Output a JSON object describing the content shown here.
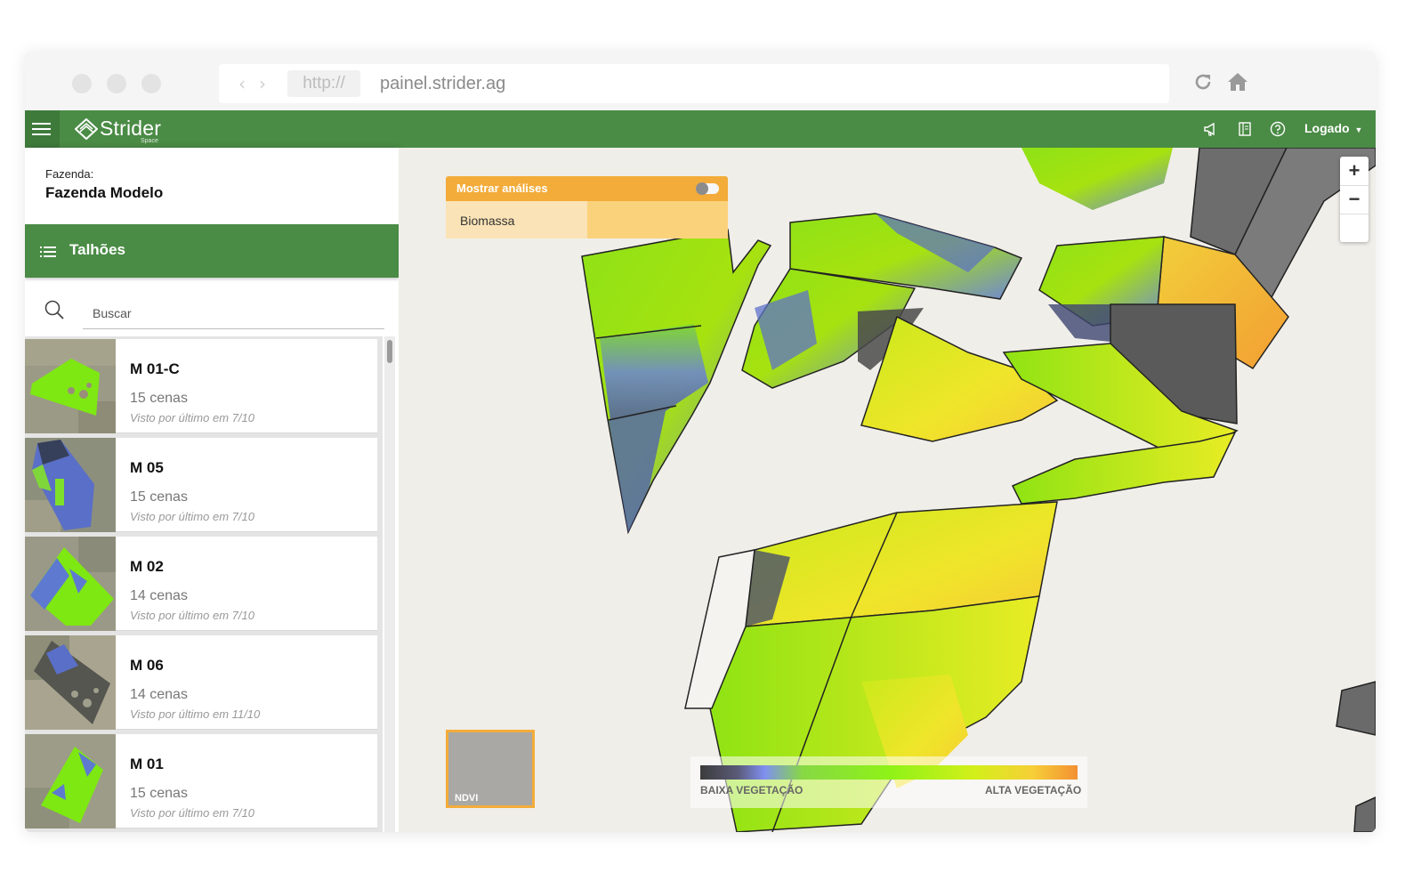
{
  "browser": {
    "protocol": "http://",
    "url": "painel.strider.ag"
  },
  "appbar": {
    "logo_text": "Strider",
    "logo_sub": "Space",
    "user_label": "Logado",
    "icons": [
      "menu-icon",
      "megaphone-icon",
      "book-icon",
      "help-icon",
      "caret-down-icon"
    ]
  },
  "sidebar": {
    "farm_label": "Fazenda:",
    "farm_name": "Fazenda Modelo",
    "plots_title": "Talhões",
    "search_placeholder": "Buscar",
    "plots": [
      {
        "name": "M 01-C",
        "scenes": "15 cenas",
        "last_seen": "Visto por último em  7/10"
      },
      {
        "name": "M 05",
        "scenes": "15 cenas",
        "last_seen": "Visto por último em  7/10"
      },
      {
        "name": "M 02",
        "scenes": "14 cenas",
        "last_seen": "Visto por último em  7/10"
      },
      {
        "name": "M 06",
        "scenes": "14 cenas",
        "last_seen": "Visto por último em  11/10"
      },
      {
        "name": "M 01",
        "scenes": "15 cenas",
        "last_seen": "Visto por último em  7/10"
      }
    ]
  },
  "map": {
    "analysis_toggle_label": "Mostrar análises",
    "analysis_item": "Biomassa",
    "zoom_in": "+",
    "zoom_out": "−",
    "layer_label": "NDVI",
    "legend_low": "BAIXA VEGETAÇÃO",
    "legend_high": "ALTA VEGETAÇÃO"
  },
  "colors": {
    "brand_green": "#4a8b45",
    "accent_orange": "#f3ac3a",
    "ndvi_low": "#3c3c3c",
    "ndvi_mid": "#8ef217",
    "ndvi_high": "#f39033"
  }
}
